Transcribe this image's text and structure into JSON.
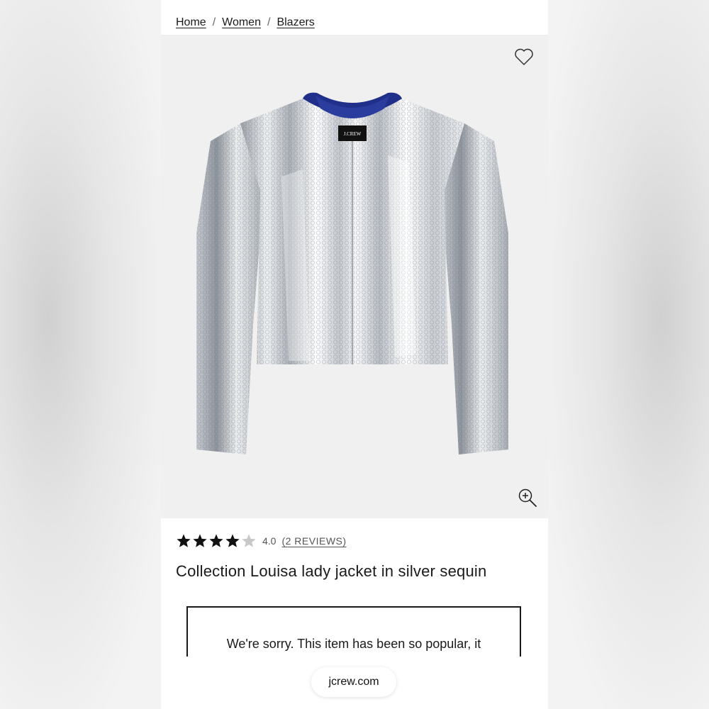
{
  "breadcrumb": {
    "items": [
      {
        "label": "Home"
      },
      {
        "label": "Women"
      },
      {
        "label": "Blazers"
      }
    ],
    "separator": "/"
  },
  "product": {
    "image": {
      "alt": "Silver sequin cropped lady jacket",
      "brand_tag": "J.CREW",
      "wishlist_icon": "heart-outline-icon",
      "zoom_icon": "zoom-in-icon"
    },
    "rating": {
      "value": 4,
      "max": 5,
      "value_label": "4.0",
      "reviews_label": "(2 REVIEWS)"
    },
    "title": "Collection Louisa lady jacket in silver sequin",
    "availability_message": "We're sorry. This item has been so popular, it"
  },
  "browser": {
    "url": "jcrew.com"
  },
  "colors": {
    "star_filled": "#111111",
    "star_empty": "#c8c8c8",
    "jacket_lining": "#1f2f8a"
  }
}
